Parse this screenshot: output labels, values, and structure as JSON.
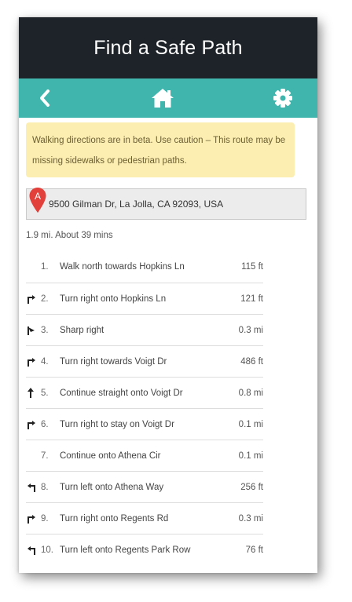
{
  "header": {
    "title": "Find a Safe Path"
  },
  "navbar": {
    "back_icon": "chevron-left-icon",
    "home_icon": "home-icon",
    "settings_icon": "gear-icon"
  },
  "alert": {
    "text": "Walking directions are in beta. Use caution – This route may be missing sidewalks or pedestrian paths."
  },
  "address": {
    "pin_letter": "A",
    "text": "9500 Gilman Dr, La Jolla, CA 92093, USA"
  },
  "summary": {
    "text": "1.9 mi. About 39 mins"
  },
  "steps": [
    {
      "num": "1.",
      "icon": "none",
      "text": "Walk north towards Hopkins Ln",
      "dist": "115 ft"
    },
    {
      "num": "2.",
      "icon": "turn-right-icon",
      "text": "Turn right onto Hopkins Ln",
      "dist": "121 ft"
    },
    {
      "num": "3.",
      "icon": "sharp-right-icon",
      "text": "Sharp right",
      "dist": "0.3 mi"
    },
    {
      "num": "4.",
      "icon": "turn-right-icon",
      "text": "Turn right towards Voigt Dr",
      "dist": "486 ft"
    },
    {
      "num": "5.",
      "icon": "straight-icon",
      "text": "Continue straight onto Voigt Dr",
      "dist": "0.8 mi"
    },
    {
      "num": "6.",
      "icon": "turn-right-icon",
      "text": "Turn right to stay on Voigt Dr",
      "dist": "0.1 mi"
    },
    {
      "num": "7.",
      "icon": "none",
      "text": "Continue onto Athena Cir",
      "dist": "0.1 mi"
    },
    {
      "num": "8.",
      "icon": "turn-left-icon",
      "text": "Turn left onto Athena Way",
      "dist": "256 ft"
    },
    {
      "num": "9.",
      "icon": "turn-right-icon",
      "text": "Turn right onto Regents Rd",
      "dist": "0.3 mi"
    },
    {
      "num": "10.",
      "icon": "turn-left-icon",
      "text": "Turn left onto Regents Park Row",
      "dist": "76 ft"
    }
  ],
  "colors": {
    "header_bg": "#1d2328",
    "navbar_bg": "#3fb5ad",
    "alert_bg": "#fbeeb0",
    "pin_red": "#e2403a"
  }
}
